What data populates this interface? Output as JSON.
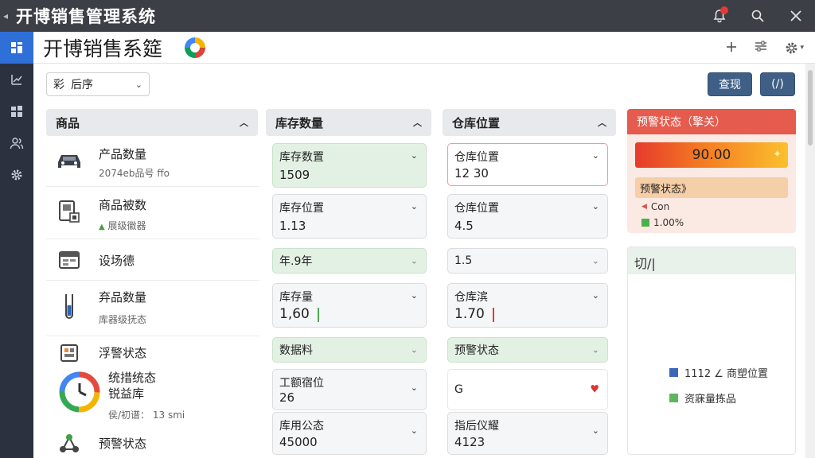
{
  "window": {
    "title": "开博销售管理系统"
  },
  "app": {
    "title": "开博销售系筵"
  },
  "colors": {
    "accent": "#2e6fd8",
    "alert": "#e55b4d",
    "primary_button": "#3f5f86"
  },
  "toolbar": {
    "sort_select": {
      "prefix": "彩",
      "value": "后序"
    },
    "query_label": "查现",
    "second_label": "(/)"
  },
  "columns": {
    "product": "商品",
    "quantity": "库存数量",
    "location": "仓库位置",
    "alert": "预警状态（擎关）"
  },
  "products": [
    {
      "icon": "car-icon",
      "name": "产品数量",
      "sub": "2074eb品号 ffo"
    },
    {
      "icon": "scanner-icon",
      "name": "商品被数",
      "sub": "展级徽器"
    },
    {
      "icon": "calendar-icon",
      "name": "设场德",
      "sub": ""
    },
    {
      "icon": "test-tube-icon",
      "name": "弃品数量",
      "sub": "库器级抚态"
    },
    {
      "icon": "chip-icon",
      "name": "浮警状态",
      "sub": ""
    },
    {
      "icon": "clock-icon",
      "name": "统措统态\n锐益库",
      "sub": "侯/初谱：  13 smi"
    },
    {
      "icon": "network-icon",
      "name": "预警状态",
      "sub": ""
    }
  ],
  "quantity_cells": [
    {
      "label": "库存数置",
      "value": "1509"
    },
    {
      "label": "库存位置",
      "value": "1.13"
    },
    {
      "label": "年.9年",
      "value": ""
    },
    {
      "label": "库存量",
      "value": "1,60"
    },
    {
      "label": "数据料",
      "value": ""
    },
    {
      "label": "工额宿位",
      "value": "26"
    },
    {
      "label": "库用公态",
      "value": "45000"
    }
  ],
  "location_cells": [
    {
      "label": "仓库位置",
      "value": "12 30"
    },
    {
      "label": "仓库位置",
      "value": "4.5"
    },
    {
      "label": "1.5",
      "value": ""
    },
    {
      "label": "仓库滨",
      "value": "1.70"
    },
    {
      "label": "预警状态",
      "value": ""
    },
    {
      "label": "G",
      "value": ""
    },
    {
      "label": "指后仪耀",
      "value": "4123"
    }
  ],
  "alert_panel": {
    "level_value": "90.00",
    "level_fraction": 0.9,
    "sub_title": "预警状态》",
    "legend": [
      {
        "symbol": "triangle",
        "text": "Con"
      },
      {
        "symbol": "square",
        "color": "#4caf50",
        "text": "1.00%"
      }
    ]
  },
  "chart_panel": {
    "title": "切/|",
    "legend": [
      {
        "color": "#3b66b8",
        "text": "1112 ∠ 商塑位置"
      },
      {
        "color": "#5cb85c",
        "text": "资寐量拣品"
      }
    ]
  }
}
